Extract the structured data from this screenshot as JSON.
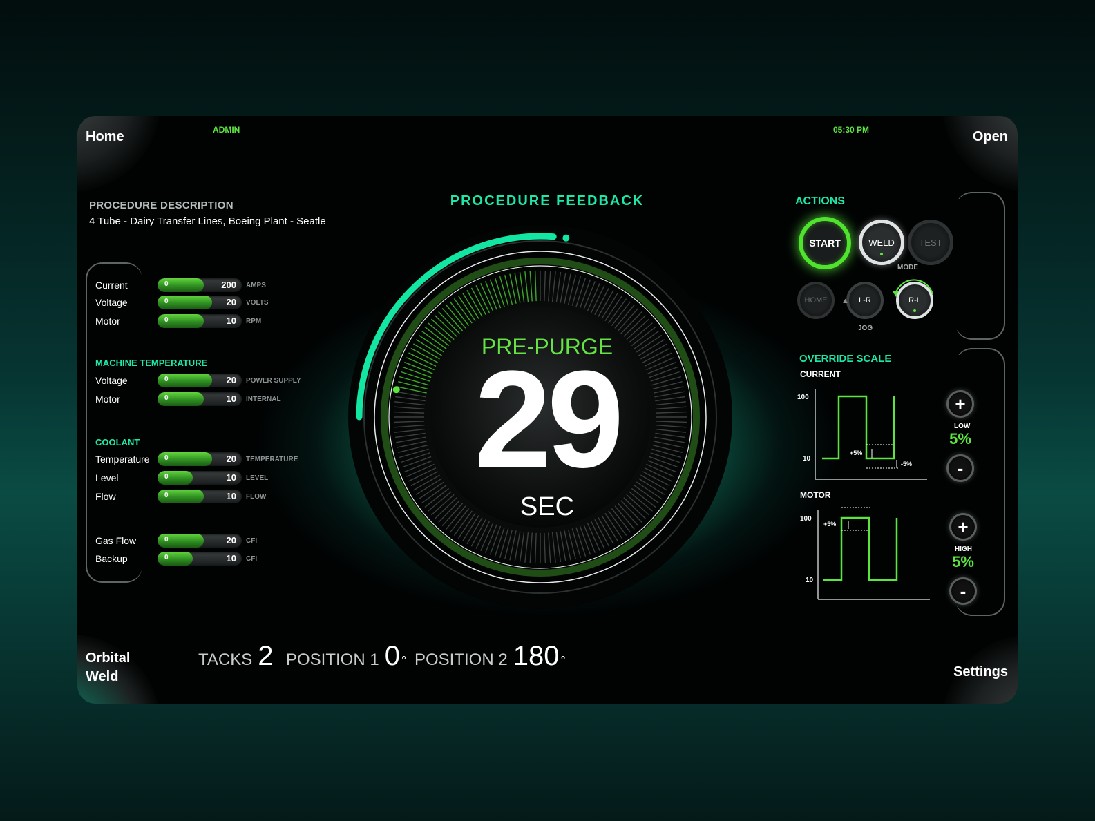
{
  "header": {
    "role": "ADMIN",
    "time": "05:30 PM"
  },
  "corners": {
    "home": "Home",
    "open": "Open",
    "orbital": "Orbital",
    "weld": "Weld",
    "settings": "Settings"
  },
  "procedure": {
    "heading": "PROCEDURE DESCRIPTION",
    "description": "4 Tube - Dairy Transfer Lines, Boeing Plant - Seatle"
  },
  "params": [
    {
      "label": "Current",
      "min": "0",
      "value": "200",
      "unit": "AMPS",
      "fill_pct": 55
    },
    {
      "label": "Voltage",
      "min": "0",
      "value": "20",
      "unit": "VOLTS",
      "fill_pct": 65
    },
    {
      "label": "Motor",
      "min": "0",
      "value": "10",
      "unit": "RPM",
      "fill_pct": 55
    }
  ],
  "machine_temperature": {
    "heading": "MACHINE TEMPERATURE",
    "rows": [
      {
        "label": "Voltage",
        "min": "0",
        "value": "20",
        "unit": "POWER SUPPLY",
        "fill_pct": 65
      },
      {
        "label": "Motor",
        "min": "0",
        "value": "10",
        "unit": "INTERNAL",
        "fill_pct": 55
      }
    ]
  },
  "coolant": {
    "heading": "COOLANT",
    "rows": [
      {
        "label": "Temperature",
        "min": "0",
        "value": "20",
        "unit": "TEMPERATURE",
        "fill_pct": 65
      },
      {
        "label": "Level",
        "min": "0",
        "value": "10",
        "unit": "LEVEL",
        "fill_pct": 42
      },
      {
        "label": "Flow",
        "min": "0",
        "value": "10",
        "unit": "FLOW",
        "fill_pct": 55
      }
    ]
  },
  "gas": [
    {
      "label": "Gas Flow",
      "min": "0",
      "value": "20",
      "unit": "CFI",
      "fill_pct": 55
    },
    {
      "label": "Backup",
      "min": "0",
      "value": "10",
      "unit": "CFI",
      "fill_pct": 42
    }
  ],
  "feedback": {
    "title": "PROCEDURE FEEDBACK",
    "state": "PRE-PURGE",
    "count": "29",
    "unit": "SEC",
    "outer_progress": 0.27,
    "inner_progress": 0.22
  },
  "actions": {
    "heading": "ACTIONS",
    "start": "START",
    "weld": "WELD",
    "test": "TEST",
    "mode": "MODE",
    "home": "HOME",
    "lr": "L-R",
    "rl": "R-L",
    "jog": "JOG"
  },
  "override": {
    "heading": "OVERRIDE SCALE",
    "current": {
      "label": "CURRENT",
      "y_high": "100",
      "y_low": "10",
      "plus": "+5%",
      "minus": "-5%"
    },
    "motor": {
      "label": "MOTOR",
      "y_high": "100",
      "y_low": "10",
      "plus": "+5%"
    },
    "low": {
      "label": "LOW",
      "value": "5%"
    },
    "high": {
      "label": "HIGH",
      "value": "5%"
    },
    "plus": "+",
    "minus": "-"
  },
  "stats": {
    "tacks_label": "TACKS",
    "tacks": "2",
    "pos1_label": "POSITION 1",
    "pos1": "0",
    "pos2_label": "POSITION 2",
    "pos2": "180",
    "degree": "°"
  },
  "colors": {
    "teal": "#1de8a8",
    "green": "#5ce53f",
    "bg": "#010303"
  }
}
